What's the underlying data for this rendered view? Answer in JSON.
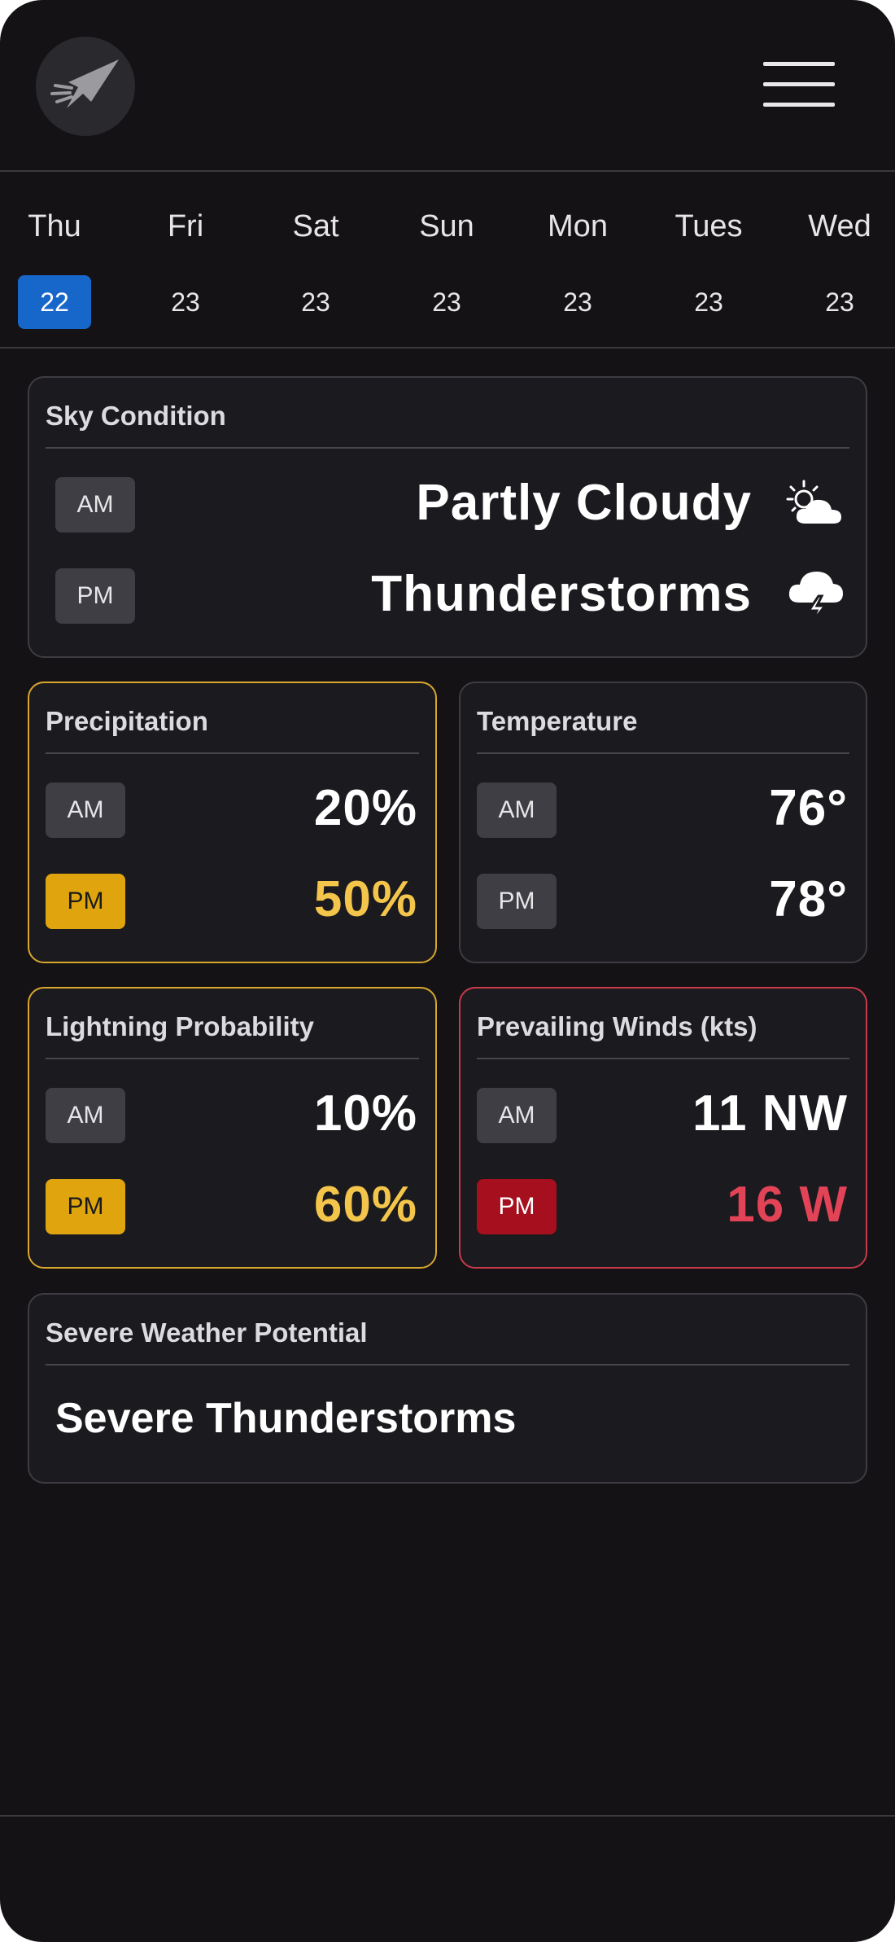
{
  "header": {
    "logo_icon": "jet-icon",
    "menu_icon": "hamburger-menu-icon"
  },
  "days": [
    {
      "name": "Thu",
      "num": "22",
      "active": true
    },
    {
      "name": "Fri",
      "num": "23"
    },
    {
      "name": "Sat",
      "num": "23"
    },
    {
      "name": "Sun",
      "num": "23"
    },
    {
      "name": "Mon",
      "num": "23"
    },
    {
      "name": "Tues",
      "num": "23"
    },
    {
      "name": "Wed",
      "num": "23"
    }
  ],
  "sky": {
    "title": "Sky Condition",
    "am_label": "AM",
    "am_value": "Partly Cloudy",
    "am_icon": "partly-cloudy-icon",
    "pm_label": "PM",
    "pm_value": "Thunderstorms",
    "pm_icon": "thunderstorm-icon"
  },
  "precipitation": {
    "title": "Precipitation",
    "am_label": "AM",
    "am_value": "20%",
    "pm_label": "PM",
    "pm_value": "50%"
  },
  "temperature": {
    "title": "Temperature",
    "am_label": "AM",
    "am_value": "76°",
    "pm_label": "PM",
    "pm_value": "78°"
  },
  "lightning": {
    "title": "Lightning Probability",
    "am_label": "AM",
    "am_value": "10%",
    "pm_label": "PM",
    "pm_value": "60%"
  },
  "winds": {
    "title": "Prevailing Winds (kts)",
    "am_label": "AM",
    "am_value": "11 NW",
    "pm_label": "PM",
    "pm_value": "16 W"
  },
  "severe": {
    "title": "Severe Weather Potential",
    "value": "Severe Thunderstorms"
  },
  "colors": {
    "accent_blue": "#1766c9",
    "warning_yellow": "#e0a50e",
    "danger_red": "#a50f1e",
    "background": "#141215"
  }
}
